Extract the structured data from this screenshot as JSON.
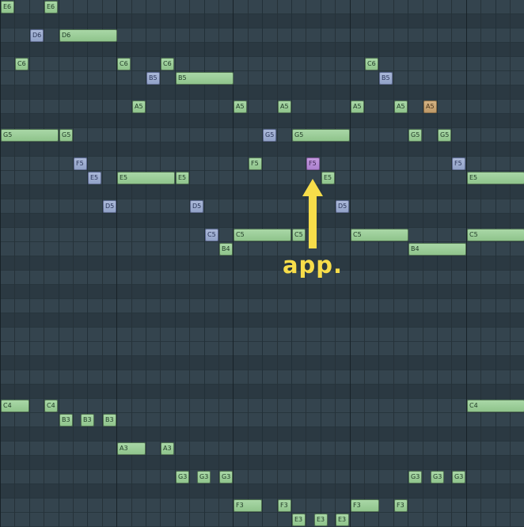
{
  "piano_roll": {
    "notes": [
      {
        "label": "E6",
        "color": "green",
        "pitch": "E6",
        "start": 0,
        "len": 1
      },
      {
        "label": "E6",
        "color": "green",
        "pitch": "E6",
        "start": 3,
        "len": 1
      },
      {
        "label": "D6",
        "color": "blue",
        "pitch": "D6",
        "start": 2,
        "len": 1
      },
      {
        "label": "D6",
        "color": "green",
        "pitch": "D6",
        "start": 4,
        "len": 4
      },
      {
        "label": "C6",
        "color": "green",
        "pitch": "C6",
        "start": 1,
        "len": 1
      },
      {
        "label": "C6",
        "color": "green",
        "pitch": "C6",
        "start": 8,
        "len": 1
      },
      {
        "label": "C6",
        "color": "green",
        "pitch": "C6",
        "start": 11,
        "len": 1
      },
      {
        "label": "C6",
        "color": "green",
        "pitch": "C6",
        "start": 25,
        "len": 1
      },
      {
        "label": "B5",
        "color": "blue",
        "pitch": "B5",
        "start": 10,
        "len": 1
      },
      {
        "label": "B5",
        "color": "green",
        "pitch": "B5",
        "start": 12,
        "len": 4
      },
      {
        "label": "B5",
        "color": "blue",
        "pitch": "B5",
        "start": 26,
        "len": 1
      },
      {
        "label": "A5",
        "color": "green",
        "pitch": "A5",
        "start": 9,
        "len": 1
      },
      {
        "label": "A5",
        "color": "green",
        "pitch": "A5",
        "start": 16,
        "len": 1
      },
      {
        "label": "A5",
        "color": "green",
        "pitch": "A5",
        "start": 19,
        "len": 1
      },
      {
        "label": "A5",
        "color": "green",
        "pitch": "A5",
        "start": 24,
        "len": 1
      },
      {
        "label": "A5",
        "color": "green",
        "pitch": "A5",
        "start": 27,
        "len": 1
      },
      {
        "label": "A5",
        "color": "orange",
        "pitch": "A5",
        "start": 29,
        "len": 1
      },
      {
        "label": "G5",
        "color": "green",
        "pitch": "G5",
        "start": 0,
        "len": 4
      },
      {
        "label": "G5",
        "color": "green",
        "pitch": "G5",
        "start": 4,
        "len": 1
      },
      {
        "label": "G5",
        "color": "blue",
        "pitch": "G5",
        "start": 18,
        "len": 1
      },
      {
        "label": "G5",
        "color": "green",
        "pitch": "G5",
        "start": 20,
        "len": 4
      },
      {
        "label": "G5",
        "color": "green",
        "pitch": "G5",
        "start": 28,
        "len": 1
      },
      {
        "label": "G5",
        "color": "green",
        "pitch": "G5",
        "start": 30,
        "len": 1
      },
      {
        "label": "F5",
        "color": "blue",
        "pitch": "F5",
        "start": 5,
        "len": 1
      },
      {
        "label": "F5",
        "color": "green",
        "pitch": "F5",
        "start": 17,
        "len": 1
      },
      {
        "label": "F5",
        "color": "purple",
        "pitch": "F5",
        "start": 21,
        "len": 1
      },
      {
        "label": "F5",
        "color": "blue",
        "pitch": "F5",
        "start": 31,
        "len": 1
      },
      {
        "label": "E5",
        "color": "blue",
        "pitch": "E5",
        "start": 6,
        "len": 1
      },
      {
        "label": "E5",
        "color": "green",
        "pitch": "E5",
        "start": 8,
        "len": 4
      },
      {
        "label": "E5",
        "color": "green",
        "pitch": "E5",
        "start": 12,
        "len": 1
      },
      {
        "label": "E5",
        "color": "green",
        "pitch": "E5",
        "start": 22,
        "len": 1
      },
      {
        "label": "E5",
        "color": "green",
        "pitch": "E5",
        "start": 32,
        "len": 4
      },
      {
        "label": "D5",
        "color": "blue",
        "pitch": "D5",
        "start": 7,
        "len": 1
      },
      {
        "label": "D5",
        "color": "blue",
        "pitch": "D5",
        "start": 13,
        "len": 1
      },
      {
        "label": "D5",
        "color": "blue",
        "pitch": "D5",
        "start": 23,
        "len": 1
      },
      {
        "label": "C5",
        "color": "blue",
        "pitch": "C5",
        "start": 14,
        "len": 1
      },
      {
        "label": "C5",
        "color": "green",
        "pitch": "C5",
        "start": 16,
        "len": 4
      },
      {
        "label": "C5",
        "color": "green",
        "pitch": "C5",
        "start": 20,
        "len": 1
      },
      {
        "label": "C5",
        "color": "green",
        "pitch": "C5",
        "start": 24,
        "len": 4
      },
      {
        "label": "C5",
        "color": "green",
        "pitch": "C5",
        "start": 32,
        "len": 4
      },
      {
        "label": "B4",
        "color": "green",
        "pitch": "B4",
        "start": 15,
        "len": 1
      },
      {
        "label": "B4",
        "color": "green",
        "pitch": "B4",
        "start": 28,
        "len": 4
      },
      {
        "label": "C4",
        "color": "green",
        "pitch": "C4",
        "start": 0,
        "len": 2
      },
      {
        "label": "C4",
        "color": "green",
        "pitch": "C4",
        "start": 3,
        "len": 1
      },
      {
        "label": "C4",
        "color": "green",
        "pitch": "C4",
        "start": 32,
        "len": 4
      },
      {
        "label": "B3",
        "color": "green",
        "pitch": "B3",
        "start": 4,
        "len": 1
      },
      {
        "label": "B3",
        "color": "green",
        "pitch": "B3",
        "start": 5.5,
        "len": 1
      },
      {
        "label": "B3",
        "color": "green",
        "pitch": "B3",
        "start": 7,
        "len": 1
      },
      {
        "label": "A3",
        "color": "green",
        "pitch": "A3",
        "start": 8,
        "len": 2
      },
      {
        "label": "A3",
        "color": "green",
        "pitch": "A3",
        "start": 11,
        "len": 1
      },
      {
        "label": "G3",
        "color": "green",
        "pitch": "G3",
        "start": 12,
        "len": 1
      },
      {
        "label": "G3",
        "color": "green",
        "pitch": "G3",
        "start": 13.5,
        "len": 1
      },
      {
        "label": "G3",
        "color": "green",
        "pitch": "G3",
        "start": 15,
        "len": 1
      },
      {
        "label": "G3",
        "color": "green",
        "pitch": "G3",
        "start": 28,
        "len": 1
      },
      {
        "label": "G3",
        "color": "green",
        "pitch": "G3",
        "start": 29.5,
        "len": 1
      },
      {
        "label": "G3",
        "color": "green",
        "pitch": "G3",
        "start": 31,
        "len": 1
      },
      {
        "label": "F3",
        "color": "green",
        "pitch": "F3",
        "start": 16,
        "len": 2
      },
      {
        "label": "F3",
        "color": "green",
        "pitch": "F3",
        "start": 19,
        "len": 1
      },
      {
        "label": "F3",
        "color": "green",
        "pitch": "F3",
        "start": 24,
        "len": 2
      },
      {
        "label": "F3",
        "color": "green",
        "pitch": "F3",
        "start": 27,
        "len": 1
      },
      {
        "label": "E3",
        "color": "green",
        "pitch": "E3",
        "start": 20,
        "len": 1
      },
      {
        "label": "E3",
        "color": "green",
        "pitch": "E3",
        "start": 21.5,
        "len": 1
      },
      {
        "label": "E3",
        "color": "green",
        "pitch": "E3",
        "start": 23,
        "len": 1
      }
    ]
  },
  "annotation": {
    "label": "app.",
    "color": "#f7dd4a",
    "target_note": "F5"
  },
  "colors": {
    "green": "#9ecf9a",
    "blue": "#9eaed0",
    "purple": "#b88dd8",
    "orange": "#caa676",
    "annotation": "#f7dd4a"
  }
}
